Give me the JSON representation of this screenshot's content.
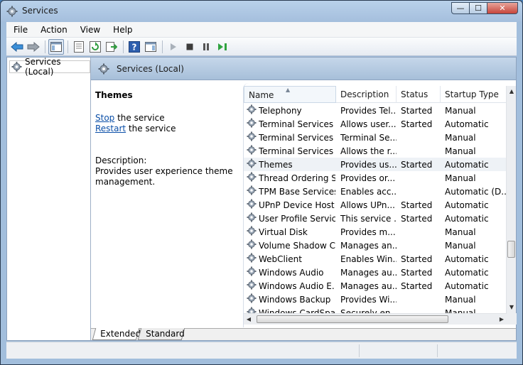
{
  "window": {
    "title": "Services",
    "controls": {
      "minimize": "—",
      "maximize": "☐",
      "close": "✕"
    }
  },
  "menu": [
    "File",
    "Action",
    "View",
    "Help"
  ],
  "tree": {
    "root_label": "Services (Local)"
  },
  "header": {
    "title": "Services (Local)"
  },
  "detail": {
    "title": "Themes",
    "stop_link": "Stop",
    "stop_rest": " the service",
    "restart_link": "Restart",
    "restart_rest": " the service",
    "description_label": "Description:",
    "description_text": "Provides user experience theme management."
  },
  "columns": {
    "name": "Name",
    "description": "Description",
    "status": "Status",
    "startup": "Startup Type"
  },
  "services": [
    {
      "name": "Telephony",
      "description": "Provides Tel...",
      "status": "Started",
      "startup": "Manual"
    },
    {
      "name": "Terminal Services",
      "description": "Allows user...",
      "status": "Started",
      "startup": "Automatic"
    },
    {
      "name": "Terminal Services ...",
      "description": "Terminal Se...",
      "status": "",
      "startup": "Manual"
    },
    {
      "name": "Terminal Services ...",
      "description": "Allows the r...",
      "status": "",
      "startup": "Manual"
    },
    {
      "name": "Themes",
      "description": "Provides us...",
      "status": "Started",
      "startup": "Automatic",
      "selected": true
    },
    {
      "name": "Thread Ordering S...",
      "description": "Provides or...",
      "status": "",
      "startup": "Manual"
    },
    {
      "name": "TPM Base Services",
      "description": "Enables acc...",
      "status": "",
      "startup": "Automatic (D..."
    },
    {
      "name": "UPnP Device Host",
      "description": "Allows UPn...",
      "status": "Started",
      "startup": "Automatic"
    },
    {
      "name": "User Profile Service",
      "description": "This service ...",
      "status": "Started",
      "startup": "Automatic"
    },
    {
      "name": "Virtual Disk",
      "description": "Provides m...",
      "status": "",
      "startup": "Manual"
    },
    {
      "name": "Volume Shadow C...",
      "description": "Manages an...",
      "status": "",
      "startup": "Manual"
    },
    {
      "name": "WebClient",
      "description": "Enables Win...",
      "status": "Started",
      "startup": "Automatic"
    },
    {
      "name": "Windows Audio",
      "description": "Manages au...",
      "status": "Started",
      "startup": "Automatic"
    },
    {
      "name": "Windows Audio E...",
      "description": "Manages au...",
      "status": "Started",
      "startup": "Automatic"
    },
    {
      "name": "Windows Backup",
      "description": "Provides Wi...",
      "status": "",
      "startup": "Manual"
    },
    {
      "name": "Windows CardSpa...",
      "description": "Securely en...",
      "status": "",
      "startup": "Manual"
    }
  ],
  "tabs": [
    "Extended",
    "Standard"
  ],
  "icons": {
    "title": "services-gear-icon",
    "toolbar": [
      "back-arrow-icon",
      "forward-arrow-icon",
      "show-hide-tree-icon",
      "properties-icon",
      "refresh-icon",
      "export-list-icon",
      "help-icon",
      "show-action-pane-icon",
      "start-service-icon",
      "stop-service-icon",
      "pause-service-icon",
      "restart-service-icon"
    ]
  },
  "colors": {
    "accent": "#0b4fa8",
    "header_band": "#a7bfd9",
    "close_button": "#c6443a"
  }
}
